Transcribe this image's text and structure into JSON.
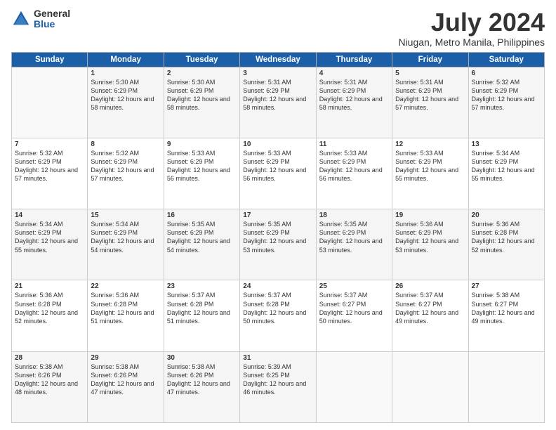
{
  "logo": {
    "general": "General",
    "blue": "Blue"
  },
  "title": "July 2024",
  "subtitle": "Niugan, Metro Manila, Philippines",
  "header_days": [
    "Sunday",
    "Monday",
    "Tuesday",
    "Wednesday",
    "Thursday",
    "Friday",
    "Saturday"
  ],
  "weeks": [
    [
      {
        "day": "",
        "sunrise": "",
        "sunset": "",
        "daylight": ""
      },
      {
        "day": "1",
        "sunrise": "Sunrise: 5:30 AM",
        "sunset": "Sunset: 6:29 PM",
        "daylight": "Daylight: 12 hours and 58 minutes."
      },
      {
        "day": "2",
        "sunrise": "Sunrise: 5:30 AM",
        "sunset": "Sunset: 6:29 PM",
        "daylight": "Daylight: 12 hours and 58 minutes."
      },
      {
        "day": "3",
        "sunrise": "Sunrise: 5:31 AM",
        "sunset": "Sunset: 6:29 PM",
        "daylight": "Daylight: 12 hours and 58 minutes."
      },
      {
        "day": "4",
        "sunrise": "Sunrise: 5:31 AM",
        "sunset": "Sunset: 6:29 PM",
        "daylight": "Daylight: 12 hours and 58 minutes."
      },
      {
        "day": "5",
        "sunrise": "Sunrise: 5:31 AM",
        "sunset": "Sunset: 6:29 PM",
        "daylight": "Daylight: 12 hours and 57 minutes."
      },
      {
        "day": "6",
        "sunrise": "Sunrise: 5:32 AM",
        "sunset": "Sunset: 6:29 PM",
        "daylight": "Daylight: 12 hours and 57 minutes."
      }
    ],
    [
      {
        "day": "7",
        "sunrise": "Sunrise: 5:32 AM",
        "sunset": "Sunset: 6:29 PM",
        "daylight": "Daylight: 12 hours and 57 minutes."
      },
      {
        "day": "8",
        "sunrise": "Sunrise: 5:32 AM",
        "sunset": "Sunset: 6:29 PM",
        "daylight": "Daylight: 12 hours and 57 minutes."
      },
      {
        "day": "9",
        "sunrise": "Sunrise: 5:33 AM",
        "sunset": "Sunset: 6:29 PM",
        "daylight": "Daylight: 12 hours and 56 minutes."
      },
      {
        "day": "10",
        "sunrise": "Sunrise: 5:33 AM",
        "sunset": "Sunset: 6:29 PM",
        "daylight": "Daylight: 12 hours and 56 minutes."
      },
      {
        "day": "11",
        "sunrise": "Sunrise: 5:33 AM",
        "sunset": "Sunset: 6:29 PM",
        "daylight": "Daylight: 12 hours and 56 minutes."
      },
      {
        "day": "12",
        "sunrise": "Sunrise: 5:33 AM",
        "sunset": "Sunset: 6:29 PM",
        "daylight": "Daylight: 12 hours and 55 minutes."
      },
      {
        "day": "13",
        "sunrise": "Sunrise: 5:34 AM",
        "sunset": "Sunset: 6:29 PM",
        "daylight": "Daylight: 12 hours and 55 minutes."
      }
    ],
    [
      {
        "day": "14",
        "sunrise": "Sunrise: 5:34 AM",
        "sunset": "Sunset: 6:29 PM",
        "daylight": "Daylight: 12 hours and 55 minutes."
      },
      {
        "day": "15",
        "sunrise": "Sunrise: 5:34 AM",
        "sunset": "Sunset: 6:29 PM",
        "daylight": "Daylight: 12 hours and 54 minutes."
      },
      {
        "day": "16",
        "sunrise": "Sunrise: 5:35 AM",
        "sunset": "Sunset: 6:29 PM",
        "daylight": "Daylight: 12 hours and 54 minutes."
      },
      {
        "day": "17",
        "sunrise": "Sunrise: 5:35 AM",
        "sunset": "Sunset: 6:29 PM",
        "daylight": "Daylight: 12 hours and 53 minutes."
      },
      {
        "day": "18",
        "sunrise": "Sunrise: 5:35 AM",
        "sunset": "Sunset: 6:29 PM",
        "daylight": "Daylight: 12 hours and 53 minutes."
      },
      {
        "day": "19",
        "sunrise": "Sunrise: 5:36 AM",
        "sunset": "Sunset: 6:29 PM",
        "daylight": "Daylight: 12 hours and 53 minutes."
      },
      {
        "day": "20",
        "sunrise": "Sunrise: 5:36 AM",
        "sunset": "Sunset: 6:28 PM",
        "daylight": "Daylight: 12 hours and 52 minutes."
      }
    ],
    [
      {
        "day": "21",
        "sunrise": "Sunrise: 5:36 AM",
        "sunset": "Sunset: 6:28 PM",
        "daylight": "Daylight: 12 hours and 52 minutes."
      },
      {
        "day": "22",
        "sunrise": "Sunrise: 5:36 AM",
        "sunset": "Sunset: 6:28 PM",
        "daylight": "Daylight: 12 hours and 51 minutes."
      },
      {
        "day": "23",
        "sunrise": "Sunrise: 5:37 AM",
        "sunset": "Sunset: 6:28 PM",
        "daylight": "Daylight: 12 hours and 51 minutes."
      },
      {
        "day": "24",
        "sunrise": "Sunrise: 5:37 AM",
        "sunset": "Sunset: 6:28 PM",
        "daylight": "Daylight: 12 hours and 50 minutes."
      },
      {
        "day": "25",
        "sunrise": "Sunrise: 5:37 AM",
        "sunset": "Sunset: 6:27 PM",
        "daylight": "Daylight: 12 hours and 50 minutes."
      },
      {
        "day": "26",
        "sunrise": "Sunrise: 5:37 AM",
        "sunset": "Sunset: 6:27 PM",
        "daylight": "Daylight: 12 hours and 49 minutes."
      },
      {
        "day": "27",
        "sunrise": "Sunrise: 5:38 AM",
        "sunset": "Sunset: 6:27 PM",
        "daylight": "Daylight: 12 hours and 49 minutes."
      }
    ],
    [
      {
        "day": "28",
        "sunrise": "Sunrise: 5:38 AM",
        "sunset": "Sunset: 6:26 PM",
        "daylight": "Daylight: 12 hours and 48 minutes."
      },
      {
        "day": "29",
        "sunrise": "Sunrise: 5:38 AM",
        "sunset": "Sunset: 6:26 PM",
        "daylight": "Daylight: 12 hours and 47 minutes."
      },
      {
        "day": "30",
        "sunrise": "Sunrise: 5:38 AM",
        "sunset": "Sunset: 6:26 PM",
        "daylight": "Daylight: 12 hours and 47 minutes."
      },
      {
        "day": "31",
        "sunrise": "Sunrise: 5:39 AM",
        "sunset": "Sunset: 6:25 PM",
        "daylight": "Daylight: 12 hours and 46 minutes."
      },
      {
        "day": "",
        "sunrise": "",
        "sunset": "",
        "daylight": ""
      },
      {
        "day": "",
        "sunrise": "",
        "sunset": "",
        "daylight": ""
      },
      {
        "day": "",
        "sunrise": "",
        "sunset": "",
        "daylight": ""
      }
    ]
  ]
}
